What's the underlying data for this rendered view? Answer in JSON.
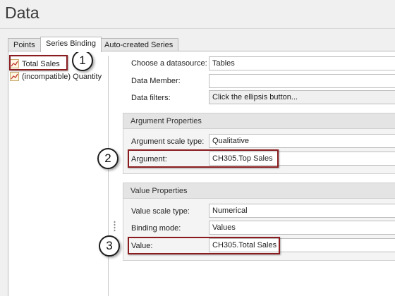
{
  "window": {
    "title": "Data"
  },
  "tabs": [
    {
      "label": "Points",
      "active": false
    },
    {
      "label": "Series Binding",
      "active": true
    },
    {
      "label": "Auto-created Series",
      "active": false
    }
  ],
  "series": [
    {
      "label": "Total Sales",
      "selected": true,
      "icon": "line-chart-icon"
    },
    {
      "label": "(incompatible) Quantity",
      "selected": false,
      "icon": "line-chart-icon"
    }
  ],
  "datasource": {
    "label": "Choose a datasource:",
    "value": "Tables",
    "member_label": "Data Member:",
    "member_value": "",
    "filters_label": "Data filters:",
    "filters_value": "Click the ellipsis button..."
  },
  "argument_group": {
    "header": "Argument Properties",
    "scale_label": "Argument scale type:",
    "scale_value": "Qualitative",
    "arg_label": "Argument:",
    "arg_value": "CH305.Top Sales"
  },
  "value_group": {
    "header": "Value Properties",
    "scale_label": "Value scale type:",
    "scale_value": "Numerical",
    "mode_label": "Binding mode:",
    "mode_value": "Values",
    "value_label": "Value:",
    "value_value": "CH305.Total Sales"
  },
  "callouts": [
    "1",
    "2",
    "3"
  ],
  "colors": {
    "highlight": "#8a1c20",
    "panel": "#f0f0f0",
    "group_header": "#e4e4e4"
  }
}
